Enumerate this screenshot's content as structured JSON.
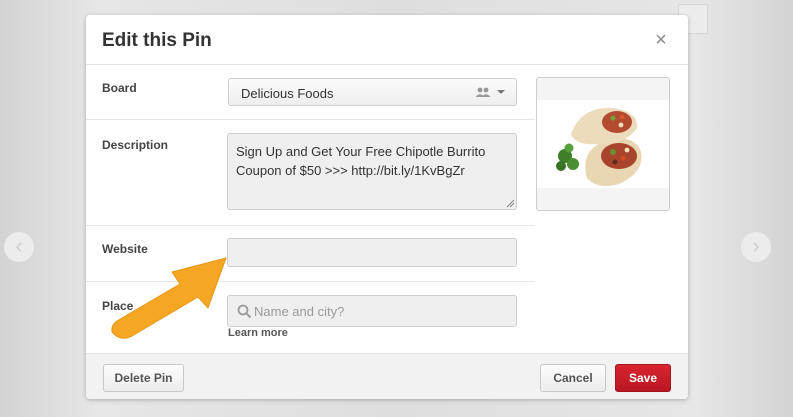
{
  "modal": {
    "title": "Edit this Pin",
    "close_label": "×"
  },
  "fields": {
    "board_label": "Board",
    "board_value": "Delicious Foods",
    "description_label": "Description",
    "description_value": "Sign Up and Get Your Free Chipotle Burrito Coupon of $50 >>> http://bit.ly/1KvBgZr",
    "website_label": "Website",
    "website_value": "",
    "place_label": "Place",
    "place_placeholder": "Name and city?",
    "learn_more": "Learn more"
  },
  "footer": {
    "delete_label": "Delete Pin",
    "cancel_label": "Cancel",
    "save_label": "Save"
  },
  "background": {
    "nav_left": "‹",
    "nav_right": "›"
  },
  "icons": {
    "close": "close-icon",
    "board_shared": "people-icon",
    "dropdown": "caret-down-icon",
    "search": "search-icon",
    "annotation": "arrow-icon"
  },
  "colors": {
    "save_button": "#c8202b",
    "annotation_arrow": "#f5a623",
    "input_bg": "#efefef",
    "footer_bg": "#f2f2f2"
  }
}
